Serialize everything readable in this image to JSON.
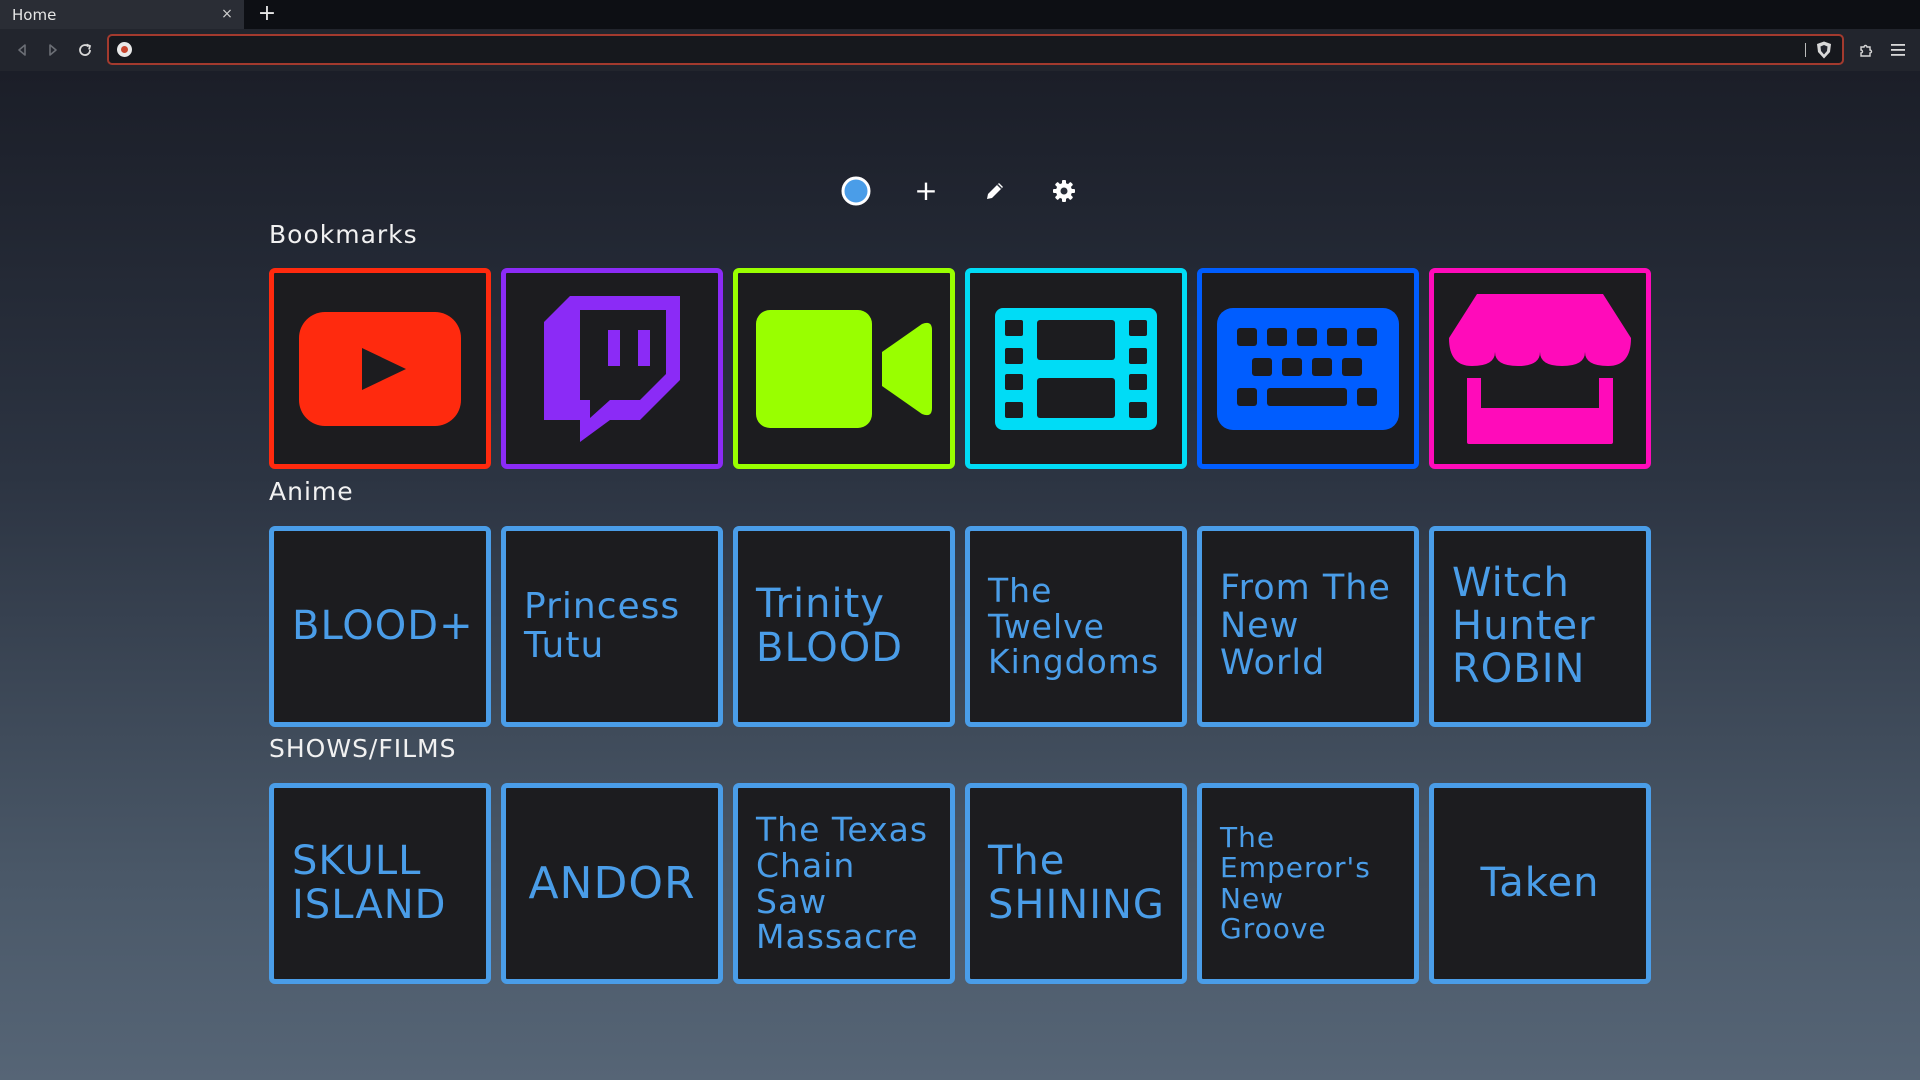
{
  "browser": {
    "tab_title": "Home",
    "tab_close": "×",
    "new_tab": "+",
    "url_value": ""
  },
  "controls": {
    "add": "+"
  },
  "sections": {
    "bookmarks": {
      "title": "Bookmarks",
      "items": [
        {
          "icon": "youtube-icon",
          "color": "#ff2a0e"
        },
        {
          "icon": "twitch-icon",
          "color": "#8b2bf6"
        },
        {
          "icon": "video-camera-icon",
          "color": "#99ff00"
        },
        {
          "icon": "film-icon",
          "color": "#00dcf6"
        },
        {
          "icon": "keyboard-icon",
          "color": "#005dff"
        },
        {
          "icon": "storefront-icon",
          "color": "#ff0bba"
        }
      ]
    },
    "anime": {
      "title": "Anime",
      "items": [
        "BLOOD+",
        "Princess Tutu",
        "Trinity BLOOD",
        "The Twelve Kingdoms",
        "From The New World",
        "Witch Hunter ROBIN"
      ]
    },
    "shows": {
      "title": "SHOWS/FILMS",
      "items": [
        "SKULL ISLAND",
        "ANDOR",
        "The Texas Chain Saw Massacre",
        "The SHINING",
        "The Emperor's New Groove",
        "Taken"
      ]
    }
  },
  "colors": {
    "accent": "#4a9de8",
    "tile_bg": "#1c1c1f"
  }
}
